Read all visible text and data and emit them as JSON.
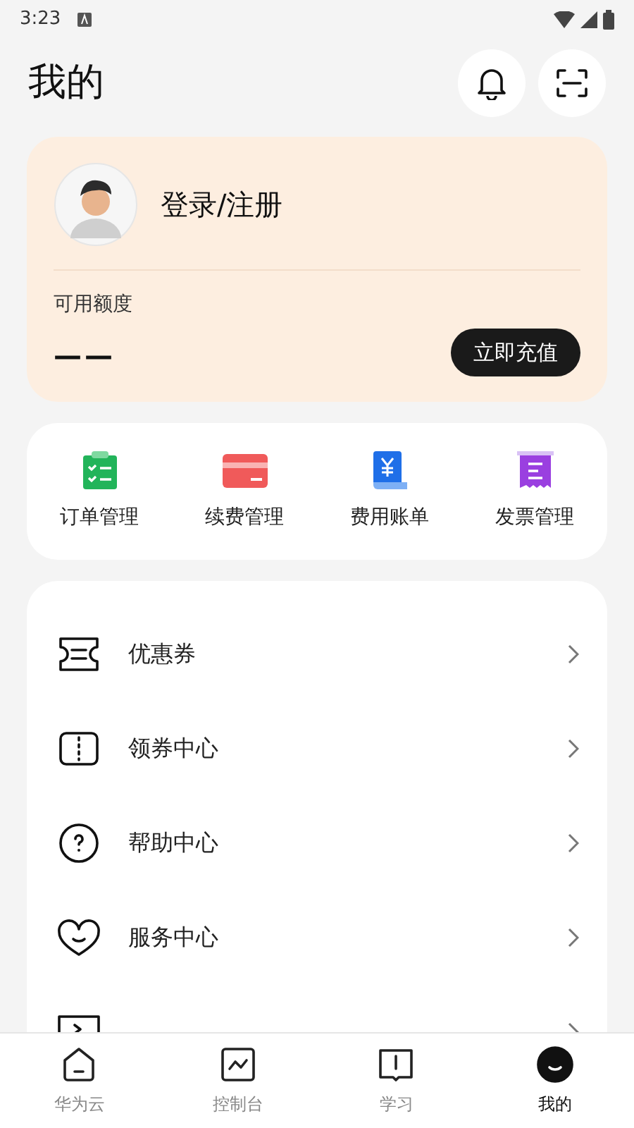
{
  "status_bar": {
    "time": "3:23"
  },
  "header": {
    "title": "我的"
  },
  "profile": {
    "login": "登录/注册",
    "credit_label": "可用额度",
    "credit_value": "——",
    "recharge": "立即充值"
  },
  "shortcuts": [
    {
      "kind": "order",
      "label": "订单管理"
    },
    {
      "kind": "renew",
      "label": "续费管理"
    },
    {
      "kind": "bill",
      "label": "费用账单"
    },
    {
      "kind": "invoice",
      "label": "发票管理"
    }
  ],
  "menu": [
    {
      "kind": "coupon",
      "label": "优惠券"
    },
    {
      "kind": "claim",
      "label": "领券中心"
    },
    {
      "kind": "help",
      "label": "帮助中心"
    },
    {
      "kind": "service",
      "label": "服务中心"
    },
    {
      "kind": "developer"
    }
  ],
  "tabs": [
    {
      "kind": "home",
      "label": "华为云",
      "selected": false
    },
    {
      "kind": "console",
      "label": "控制台",
      "selected": false
    },
    {
      "kind": "learn",
      "label": "学习",
      "selected": false
    },
    {
      "kind": "me",
      "label": "我的",
      "selected": true
    }
  ]
}
